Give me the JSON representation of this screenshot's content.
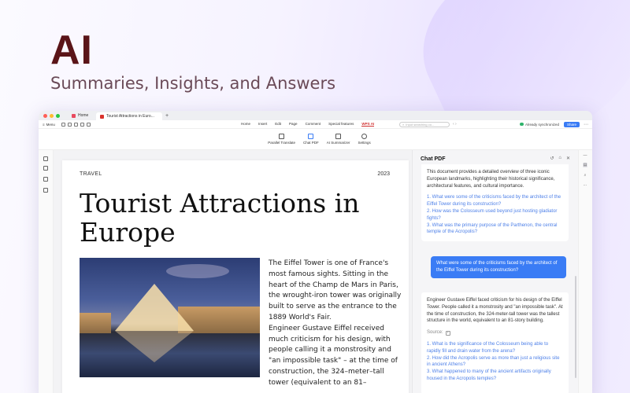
{
  "hero": {
    "title": "AI",
    "subtitle": "Summaries, Insights, and Answers"
  },
  "tabs": {
    "home": "Home",
    "active": "Tourist Attractions in Euro..."
  },
  "menubar": {
    "menu_label": "Menu",
    "tabs": [
      "Home",
      "Insert",
      "Edit",
      "Page",
      "Comment",
      "Special features"
    ],
    "ai_tab": "WPS AI",
    "search_placeholder": "Input searching co...",
    "sync_status": "Already synchronized",
    "share_label": "Share"
  },
  "ribbon": {
    "items": [
      "Parallel Translate",
      "Chat PDF",
      "AI Summarizer",
      "Settings"
    ]
  },
  "document": {
    "label": "TRAVEL",
    "year": "2023",
    "title": "Tourist Attractions in Europe",
    "body_1": "The Eiffel Tower is one of France's most famous sights. Sitting in the heart of the Champ de Mars in Paris, the wrought-iron tower was originally built to serve as the entrance to the 1889 World's Fair.",
    "body_2": "Engineer Gustave Eiffel received much criticism for his design, with people calling it a monstrosity and \"an impossible task\" – at the time of construction, the 324–meter–tall tower (equivalent to an 81–"
  },
  "chat": {
    "title": "Chat PDF",
    "summary": "This document provides a detailed overview of three iconic European landmarks, highlighting their historical significance, architectural features, and cultural importance.",
    "suggested": [
      "1. What were some of the criticisms faced by the architect of the Eiffel Tower during its construction?",
      "2. How was the Colosseum used beyond just hosting gladiator fights?",
      "3. What was the primary purpose of the Parthenon, the central temple of the Acropolis?"
    ],
    "user_question": "What were some of the criticisms faced by the architect of the Eiffel Tower during its construction?",
    "answer": "Engineer Gustave Eiffel faced criticism for his design of the Eiffel Tower. People called it a monstrosity and \"an impossible task\". At the time of construction, the 324-meter-tall tower was the tallest structure in the world, equivalent to an 81-story building.",
    "source_label": "Source:",
    "source_num": "1",
    "followups": [
      "1. What is the significance of the Colosseum being able to rapidly fill and drain water from the arena?",
      "2. How did the Acropolis serve as more than just a religious site in ancient Athens?",
      "3. What happened to many of the ancient artifacts originally housed in the Acropolis temples?"
    ]
  },
  "colors": {
    "accent": "#3a7cf5",
    "hero_title": "#5a1418",
    "ai_tab": "#d0302f",
    "link": "#4e80e8"
  }
}
